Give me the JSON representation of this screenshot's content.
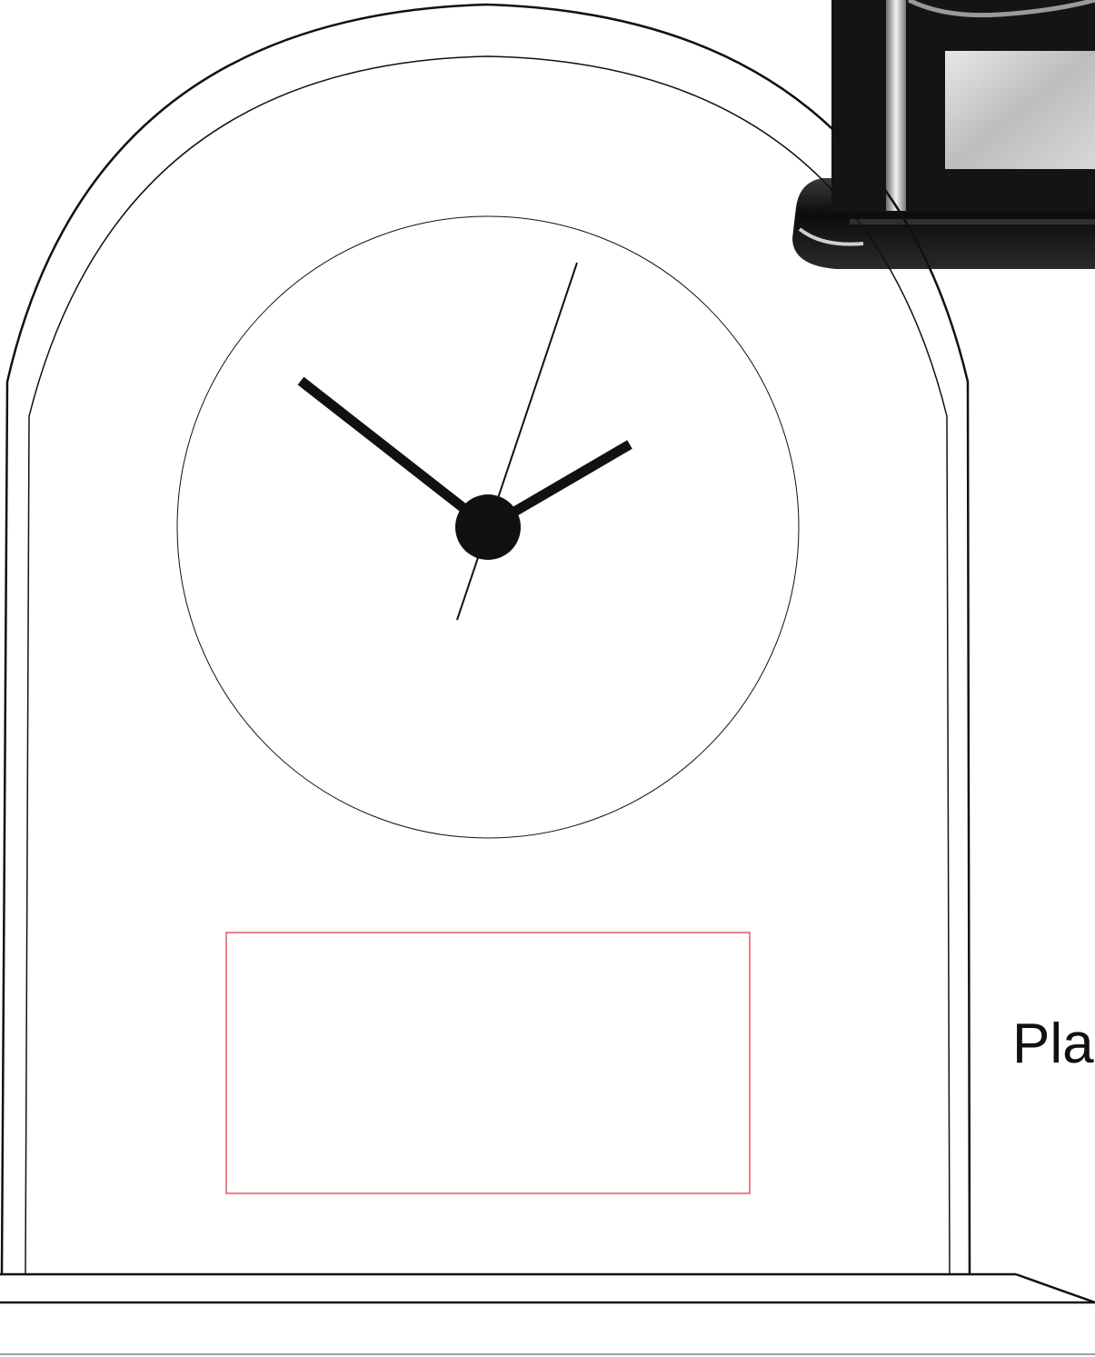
{
  "drawing": {
    "side_label": "Pla",
    "colors": {
      "line": "#111111",
      "engrave_area": "#e0303a",
      "photo_dark": "#1a1a1a",
      "photo_plate": "#cfcfcf"
    }
  }
}
